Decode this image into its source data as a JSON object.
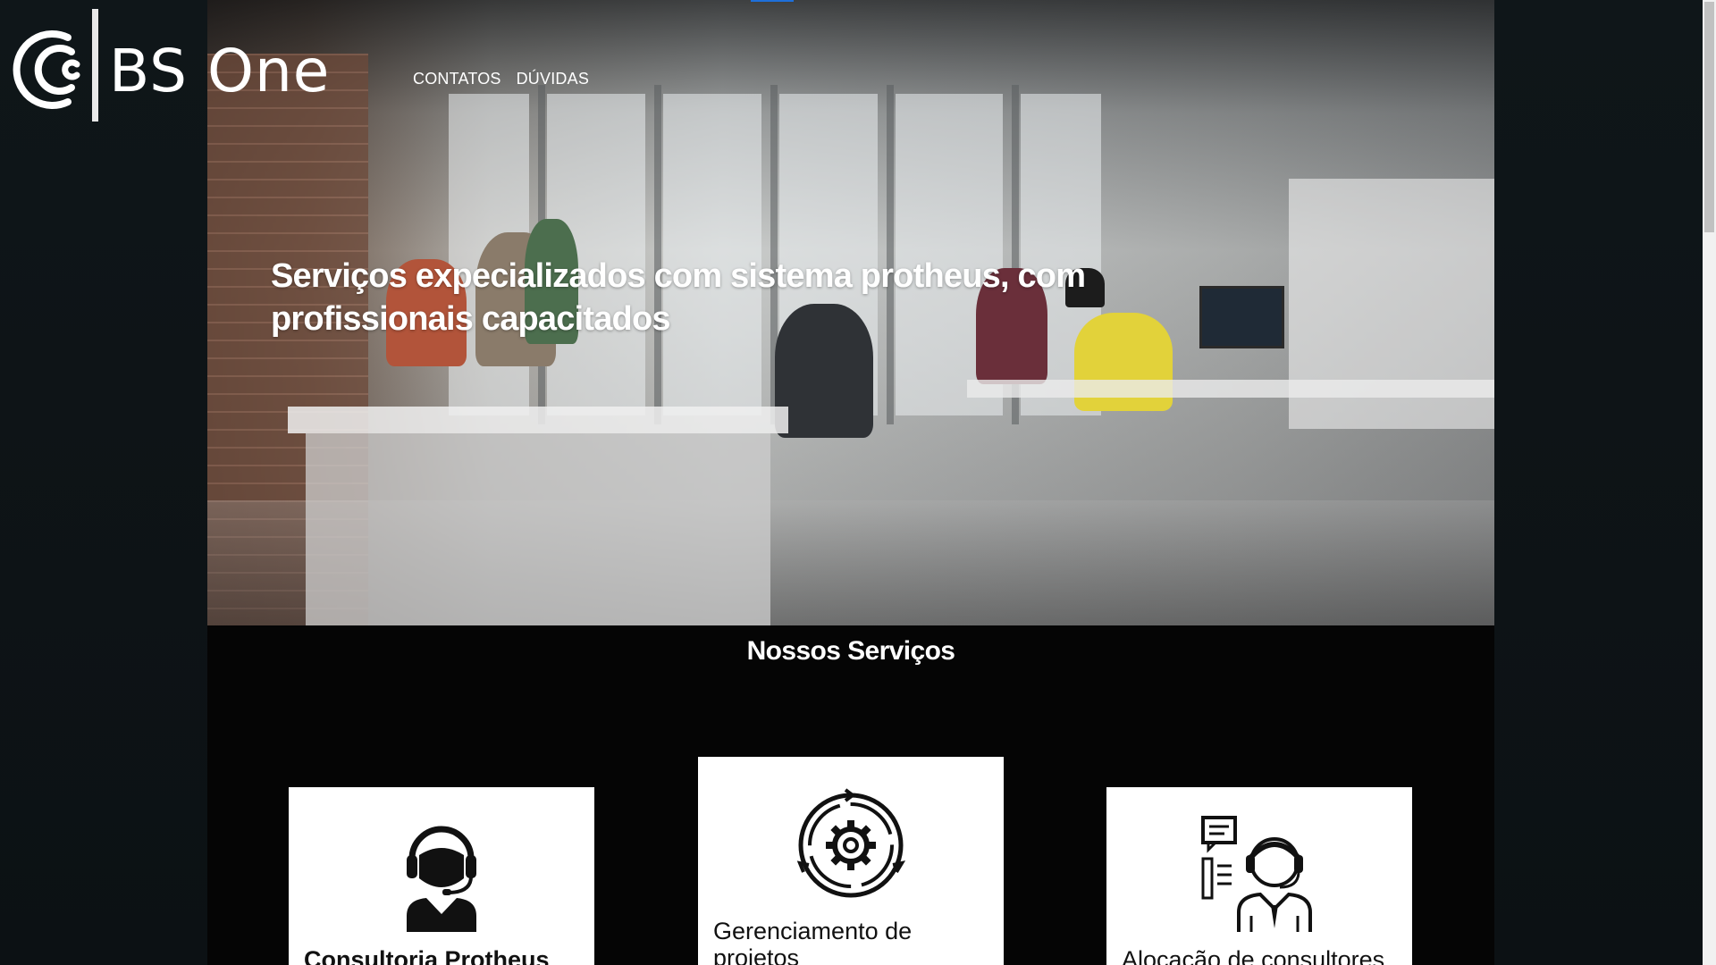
{
  "header": {
    "brand_name": "BS One",
    "nav": [
      {
        "label": "CONTATOS"
      },
      {
        "label": "DÚVIDAS"
      }
    ]
  },
  "hero": {
    "title": "Serviços expecializados com sistema protheus, com profissionais capacitados"
  },
  "services": {
    "heading": "Nossos Serviços",
    "cards": [
      {
        "title": "Consultoria Protheus",
        "icon": "headset-consultant-icon"
      },
      {
        "title": "Gerenciamento de projetos",
        "icon": "gear-cycle-icon"
      },
      {
        "title": "Alocação de consultores",
        "icon": "support-agent-icon"
      }
    ]
  },
  "colors": {
    "page_bg": "#0f1519",
    "main_bg": "#050505",
    "card_bg": "#ffffff",
    "accent_indicator": "#1e6fd9"
  }
}
